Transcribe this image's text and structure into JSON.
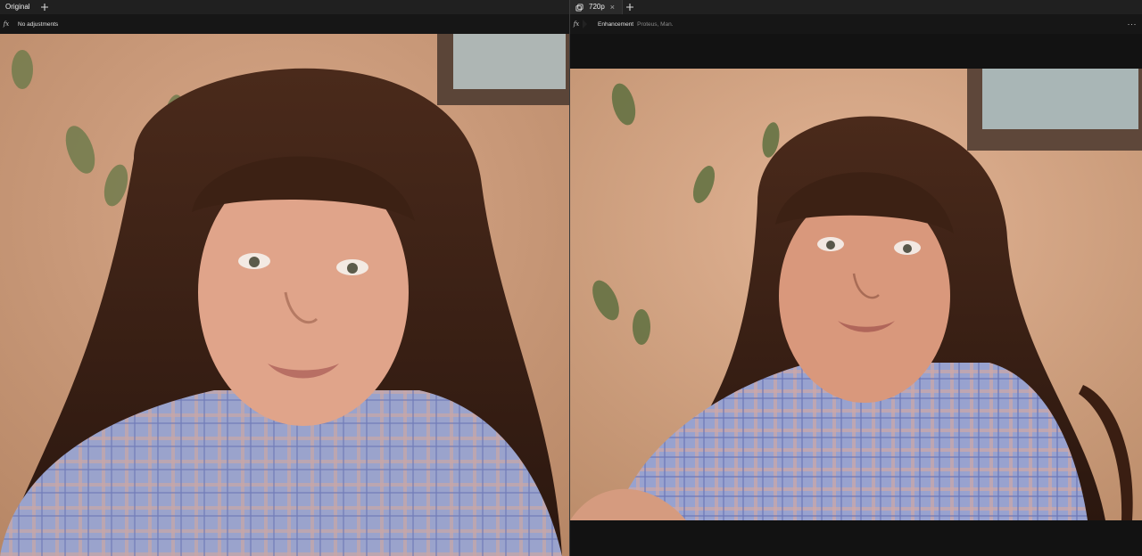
{
  "left_pane": {
    "tab_label": "Original",
    "adjustment_text": "No adjustments"
  },
  "right_pane": {
    "tab_label": "720p",
    "adjustment_label": "Enhancement",
    "adjustment_detail": "Proteus, Man.",
    "more_label": "···"
  },
  "icons": {
    "fx": "fx-icon",
    "add_tab": "plus-icon",
    "close_tab": "close-icon",
    "preset": "preset-icon",
    "more": "more-icon"
  },
  "colors": {
    "background": "#121212",
    "tabbar": "#202020",
    "adjbar": "#161616"
  }
}
